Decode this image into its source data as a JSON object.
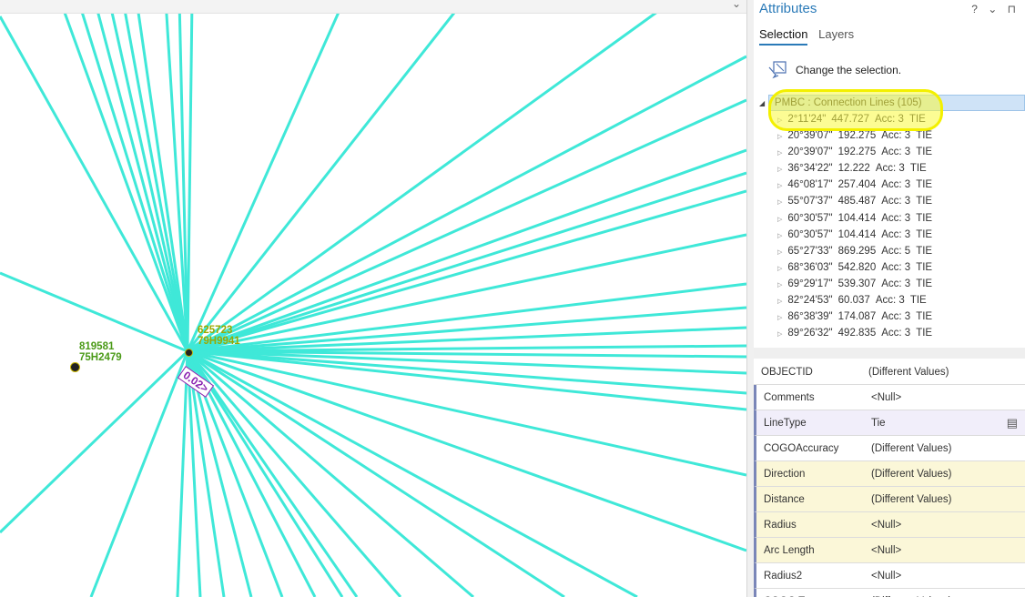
{
  "map": {
    "points": [
      {
        "id": "819581",
        "code": "75H2479"
      },
      {
        "id": "625723",
        "code": "79H9941"
      }
    ],
    "distance_label": "0.02>",
    "line_color": "#3fe8d8"
  },
  "panel": {
    "title": "Attributes",
    "controls": "? ⌄ ⊓",
    "tabs": [
      "Selection",
      "Layers"
    ],
    "change_selection": "Change the selection.",
    "group_label": "PMBC : Connection Lines (105)",
    "rows": [
      {
        "dir": "2°11'24\"",
        "dist": "447.727",
        "acc": "Acc: 3",
        "type": "TIE"
      },
      {
        "dir": "20°39'07\"",
        "dist": "192.275",
        "acc": "Acc: 3",
        "type": "TIE"
      },
      {
        "dir": "20°39'07\"",
        "dist": "192.275",
        "acc": "Acc: 3",
        "type": "TIE"
      },
      {
        "dir": "36°34'22\"",
        "dist": "12.222",
        "acc": "Acc: 3",
        "type": "TIE"
      },
      {
        "dir": "46°08'17\"",
        "dist": "257.404",
        "acc": "Acc: 3",
        "type": "TIE"
      },
      {
        "dir": "55°07'37\"",
        "dist": "485.487",
        "acc": "Acc: 3",
        "type": "TIE"
      },
      {
        "dir": "60°30'57\"",
        "dist": "104.414",
        "acc": "Acc: 3",
        "type": "TIE"
      },
      {
        "dir": "60°30'57\"",
        "dist": "104.414",
        "acc": "Acc: 3",
        "type": "TIE"
      },
      {
        "dir": "65°27'33\"",
        "dist": "869.295",
        "acc": "Acc: 5",
        "type": "TIE"
      },
      {
        "dir": "68°36'03\"",
        "dist": "542.820",
        "acc": "Acc: 3",
        "type": "TIE"
      },
      {
        "dir": "69°29'17\"",
        "dist": "539.307",
        "acc": "Acc: 3",
        "type": "TIE"
      },
      {
        "dir": "82°24'53\"",
        "dist": "60.037",
        "acc": "Acc: 3",
        "type": "TIE"
      },
      {
        "dir": "86°38'39\"",
        "dist": "174.087",
        "acc": "Acc: 3",
        "type": "TIE"
      },
      {
        "dir": "89°26'32\"",
        "dist": "492.835",
        "acc": "Acc: 3",
        "type": "TIE"
      }
    ],
    "fields": [
      {
        "key": "OBJECTID",
        "value": "(Different Values)",
        "style": ""
      },
      {
        "key": "Comments",
        "value": "<Null>",
        "style": "marked"
      },
      {
        "key": "LineType",
        "value": "Tie",
        "style": "marked purple"
      },
      {
        "key": "COGOAccuracy",
        "value": "(Different Values)",
        "style": "marked"
      },
      {
        "key": "Direction",
        "value": "(Different Values)",
        "style": "marked yellow"
      },
      {
        "key": "Distance",
        "value": "(Different Values)",
        "style": "marked yellow"
      },
      {
        "key": "Radius",
        "value": "<Null>",
        "style": "marked yellow"
      },
      {
        "key": "Arc Length",
        "value": "<Null>",
        "style": "marked yellow"
      },
      {
        "key": "Radius2",
        "value": "<Null>",
        "style": "marked"
      },
      {
        "key": "COGO Type",
        "value": "(Different Values)",
        "style": "marked"
      }
    ]
  }
}
